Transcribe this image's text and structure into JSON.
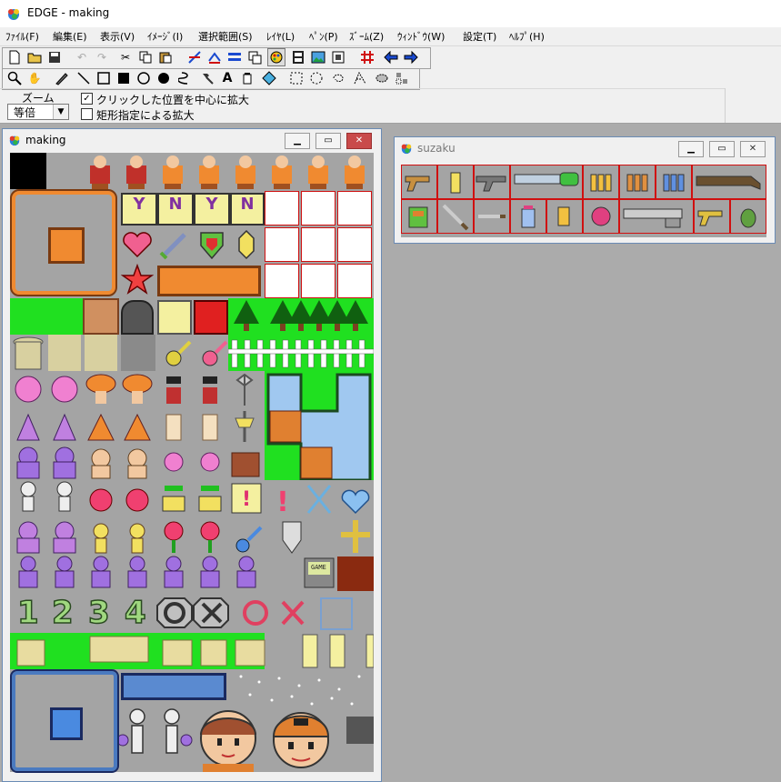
{
  "app": {
    "title": "EDGE - making"
  },
  "menu": [
    "ﾌｧｲﾙ(F)",
    "編集(E)",
    "表示(V)",
    "ｲﾒｰｼﾞ(I)",
    "選択範囲(S)",
    "ﾚｲﾔ(L)",
    "ﾍﾟﾝ(P)",
    "ｽﾞｰﾑ(Z)",
    "ｳｨﾝﾄﾞｳ(W)",
    "設定(T)",
    "ﾍﾙﾌﾟ(H)"
  ],
  "toolbar1_icons": [
    "new-file-icon",
    "open-folder-icon",
    "save-icon",
    "undo-icon",
    "redo-icon",
    "cut-icon",
    "copy-icon",
    "paste-icon",
    "grid-arrange-icon",
    "mirror-icon",
    "pattern-icon",
    "layer-icon",
    "palette-icon",
    "film-icon",
    "image-icon",
    "page-icon",
    "grid-icon",
    "arrow-left-icon",
    "arrow-right-icon"
  ],
  "toolbar2_icons": [
    "magnifier-icon",
    "hand-icon",
    "pen-icon",
    "line-icon",
    "rect-outline-icon",
    "rect-fill-icon",
    "circle-outline-icon",
    "circle-fill-icon",
    "curve-icon",
    "hammer-icon",
    "text-icon",
    "bucket-icon",
    "fill-diamond-icon",
    "rect-select-icon",
    "ellipse-select-icon",
    "lasso-icon",
    "polygon-select-icon",
    "magic-lasso-icon",
    "color-select-icon"
  ],
  "zoom": {
    "label": "ズーム",
    "value": "等倍"
  },
  "options": {
    "center_zoom": {
      "label": "クリックした位置を中心に拡大",
      "checked": true
    },
    "rect_zoom": {
      "label": "矩形指定による拡大",
      "checked": false
    }
  },
  "windows": {
    "making": {
      "title": "making"
    },
    "suzaku": {
      "title": "suzaku"
    }
  },
  "sprites": {
    "yes_label": "Y",
    "no_label": "N",
    "numbers": [
      "1",
      "2",
      "3",
      "4"
    ],
    "game_label": "GAME"
  },
  "colors": {
    "canvas": "#a4a4a4",
    "mdi_background": "#ababab",
    "grid_red": "#d01010",
    "accent_orange": "#f08a30",
    "grass_green": "#20e020"
  }
}
